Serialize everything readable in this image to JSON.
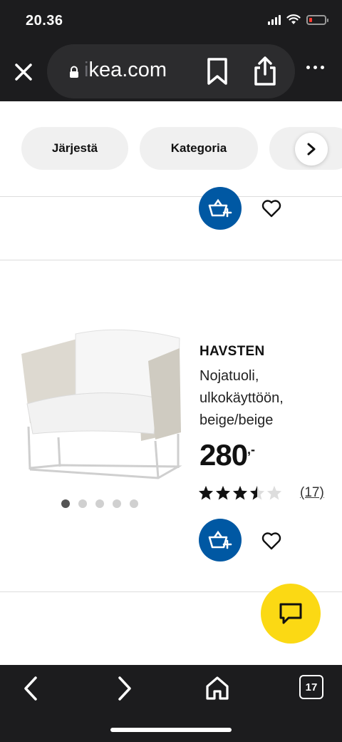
{
  "status_bar": {
    "time": "20.36",
    "icons": [
      "signal-icon",
      "wifi-icon",
      "battery-icon"
    ]
  },
  "browser": {
    "url_faded": "i",
    "url_text": "kea.com",
    "icons": {
      "close": "close-icon",
      "lock": "lock-icon",
      "bookmark": "bookmark-icon",
      "share": "share-icon",
      "more": "more-icon"
    }
  },
  "filters": {
    "chips": [
      "Järjestä",
      "Kategoria",
      ""
    ],
    "next_icon": "chevron-right-icon"
  },
  "product": {
    "name": "HAVSTEN",
    "description": "Nojatuoli, ulkokäyttöön, beige/beige",
    "price": "280",
    "price_suffix": ",-",
    "rating": 3.5,
    "rating_max": 5,
    "review_count": "(17)",
    "image_dots": 5,
    "active_dot": 0
  },
  "toolbar": {
    "tabs_count": "17"
  },
  "colors": {
    "ikea_blue": "#0058a3",
    "ikea_yellow": "#fbd914",
    "dark_chrome": "#1c1c1e",
    "battery_low": "#ff3b30"
  }
}
